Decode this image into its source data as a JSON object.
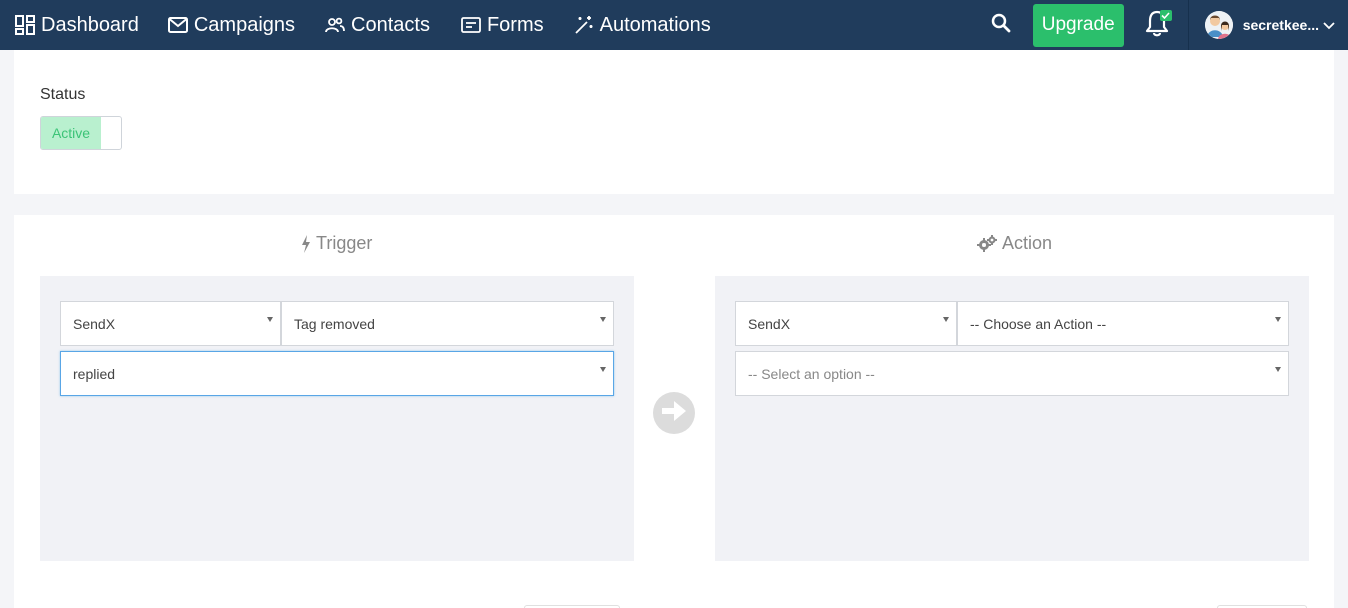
{
  "nav": {
    "items": [
      {
        "label": "Dashboard",
        "icon": "grid-icon"
      },
      {
        "label": "Campaigns",
        "icon": "envelope-icon"
      },
      {
        "label": "Contacts",
        "icon": "users-icon"
      },
      {
        "label": "Forms",
        "icon": "form-icon"
      },
      {
        "label": "Automations",
        "icon": "magic-wand-icon"
      }
    ],
    "upgrade_label": "Upgrade",
    "username": "secretkee..."
  },
  "status": {
    "label": "Status",
    "toggle_label": "Active"
  },
  "trigger": {
    "title": "Trigger",
    "app_select": "SendX",
    "event_select": "Tag removed",
    "option_select": "replied"
  },
  "action": {
    "title": "Action",
    "app_select": "SendX",
    "action_select": "-- Choose an Action --",
    "option_select": "-- Select an option --"
  },
  "colors": {
    "navbar": "#203c5c",
    "upgrade": "#2bbf6c",
    "toggle_on_bg": "#b9f0cf",
    "toggle_on_text": "#3cc477",
    "panel_bg": "#f1f2f6",
    "focus_border": "#59a6e6"
  }
}
